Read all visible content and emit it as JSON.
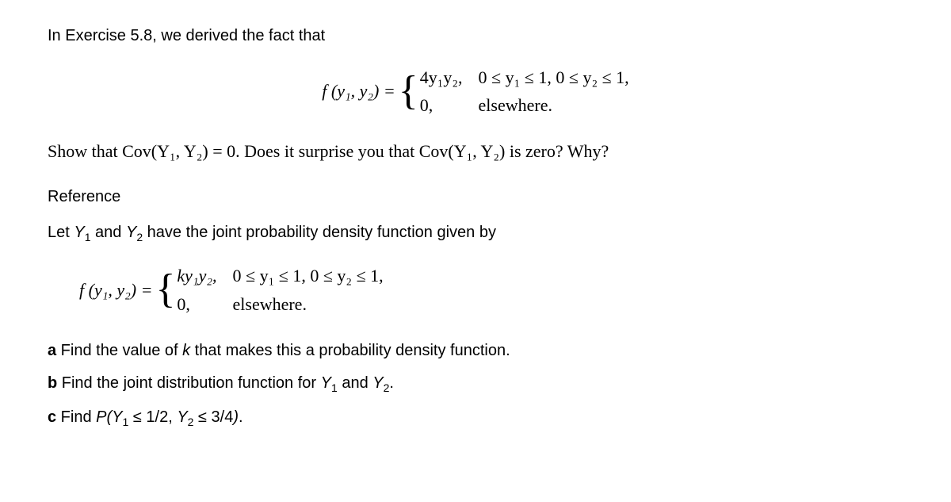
{
  "intro": "In Exercise 5.8, we derived the fact that",
  "pdf1": {
    "lhs": "f (y₁, y₂) =",
    "case1_expr": "4y₁y₂,",
    "case1_cond": "0 ≤ y₁ ≤ 1, 0 ≤ y₂ ≤ 1,",
    "case2_expr": "0,",
    "case2_cond": "elsewhere."
  },
  "question": "Show that Cov(Y₁, Y₂) = 0. Does it surprise you that Cov(Y₁, Y₂) is zero? Why?",
  "reference_label": "Reference",
  "reference_text": "Let Y₁ and Y₂ have the joint probability density function given by",
  "pdf2": {
    "lhs": "f (y₁, y₂) =",
    "case1_expr": "ky₁y₂,",
    "case1_cond": "0 ≤ y₁ ≤ 1, 0 ≤ y₂ ≤ 1,",
    "case2_expr": "0,",
    "case2_cond": "elsewhere."
  },
  "parts": {
    "a_label": "a",
    "a_text": " Find the value of k that makes this a probability density function.",
    "b_label": "b",
    "b_text": " Find the joint distribution function for Y₁ and Y₂.",
    "c_label": "c",
    "c_text": " Find P(Y₁ ≤ 1/2, Y₂ ≤ 3/4)."
  }
}
